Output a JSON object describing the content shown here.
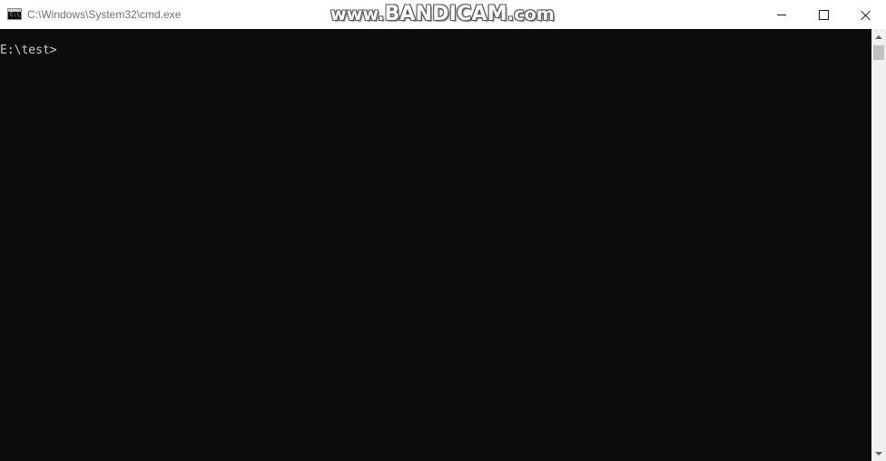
{
  "window": {
    "title": "C:\\Windows\\System32\\cmd.exe",
    "icon": "cmd-icon",
    "icon_glyph": "C:\\"
  },
  "watermark": {
    "prefix": "www.",
    "brand": "BANDICAM",
    "suffix": ".com"
  },
  "controls": {
    "minimize_icon": "minimize-icon",
    "maximize_icon": "maximize-icon",
    "close_icon": "close-icon"
  },
  "console": {
    "prompt": "E:\\test>",
    "background": "#0c0c0c",
    "foreground": "#cccccc"
  },
  "scrollbar": {
    "up_icon": "arrow-up-icon",
    "down_icon": "arrow-down-icon"
  }
}
